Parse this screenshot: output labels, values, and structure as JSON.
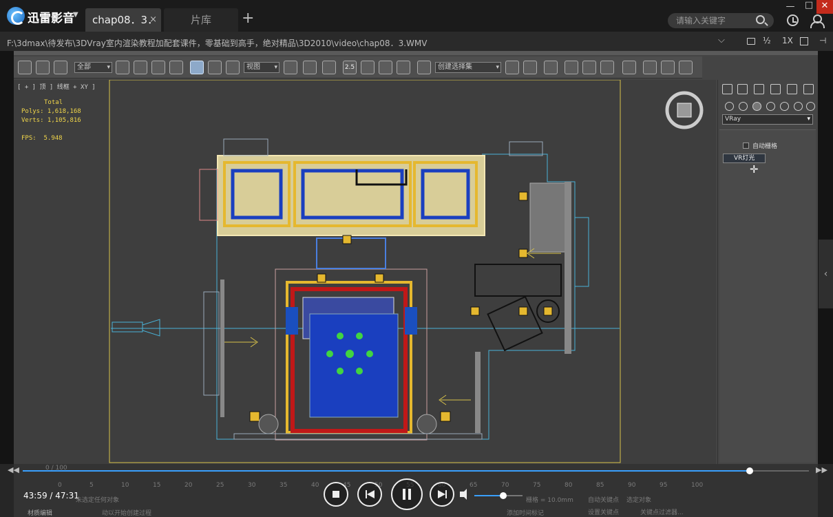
{
  "app": {
    "name": "迅雷影音"
  },
  "tabs": [
    {
      "label": "chap08．3．",
      "close": "×"
    },
    {
      "label": "片库"
    }
  ],
  "tab_add": "+",
  "search": {
    "placeholder": "请输入关键字"
  },
  "window": {
    "minimize": "—",
    "maximize": "□",
    "close": "✕"
  },
  "file_path": "F:\\3dmax\\待发布\\3DVray室内渲染教程加配套课件，零基础到高手，绝对精品\\3D2010\\video\\chap08．3.WMV",
  "pathbar": {
    "chevron": "⌵",
    "speed_half": "½",
    "speed_1x": "1X",
    "pin": "⊣"
  },
  "viewport": {
    "label": "[ + ] 顶 ] 线框 + XY ]",
    "stats": {
      "total_label": "Total",
      "polys": "Polys: 1,618,168",
      "verts": "Verts: 1,105,816",
      "fps": "FPS:  5.948"
    }
  },
  "max_toolbar": {
    "filter_all": "全部",
    "ref_coord": "视图",
    "selection_set": "创建选择集",
    "snap_25": "2.5"
  },
  "command_panel": {
    "renderer": "VRay",
    "autogrid": "自动栅格",
    "vr_light": "VR灯光"
  },
  "player": {
    "time": "43:59 / 47:31",
    "progress": 0.925,
    "volume": 0.6,
    "seek_back": "◀◀",
    "seek_fwd": "▶▶",
    "side_arrow": "‹"
  },
  "background_status": {
    "not_selected": "未选定任何对象",
    "click_create": "动以开始创建过程",
    "auto_key": "自动关键点",
    "selected_obj": "选定对象",
    "set_key": "设置关键点",
    "key_filter": "关键点过滤器...",
    "add_time_tag": "添加时间标记",
    "grid": "栅格 = 10.0mm",
    "frame_range": "0 / 100",
    "ticks": [
      "0",
      "5",
      "10",
      "15",
      "20",
      "25",
      "30",
      "35",
      "40",
      "45",
      "50",
      "55",
      "60",
      "65",
      "70",
      "75",
      "80",
      "85",
      "90",
      "95",
      "100"
    ],
    "material_editor": "材质编辑"
  },
  "colors": {
    "accent": "#3aa0ff",
    "close_red": "#c42b1c",
    "viewport_bg": "#3e3e3e",
    "yellow_line": "#f1d64a",
    "blue_fill": "#1a3fbf",
    "red_frame": "#c01818"
  }
}
